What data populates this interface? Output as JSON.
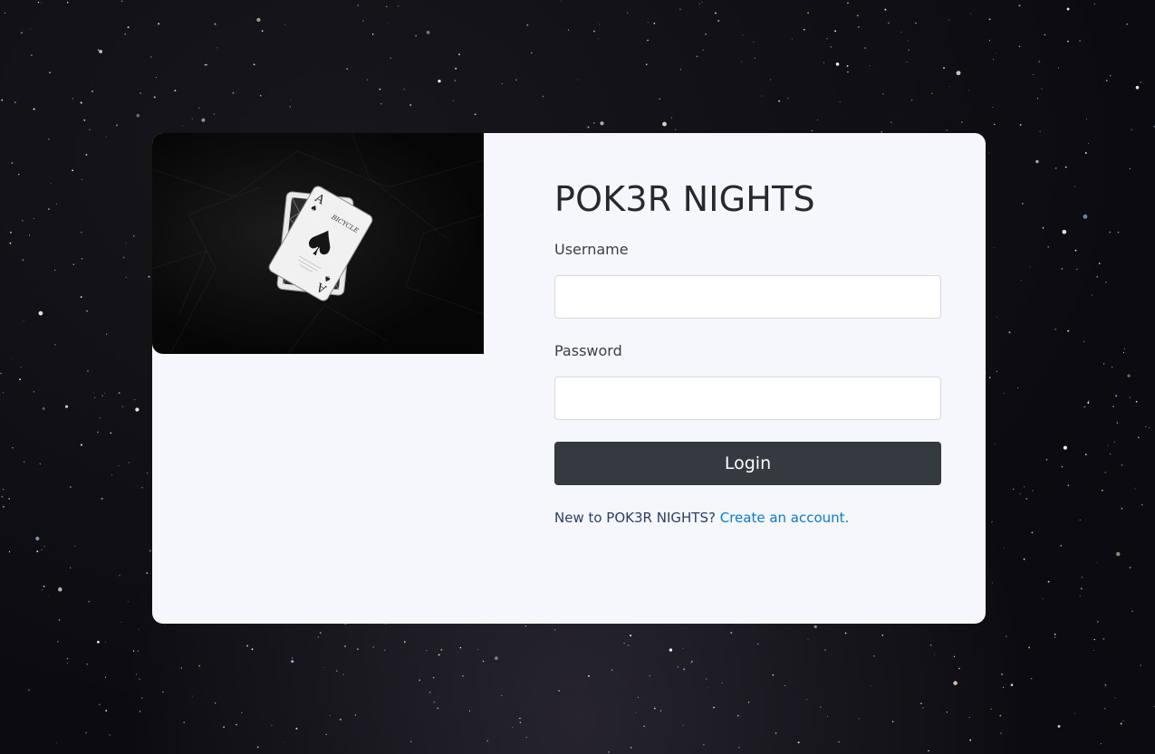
{
  "app": {
    "title": "POK3R NIGHTS"
  },
  "hero": {
    "image_description_icon": "playing-cards-icon",
    "card_rank": "A",
    "card_suit": "♠",
    "card_brand": "BICYCLE"
  },
  "form": {
    "username_label": "Username",
    "username_value": "",
    "password_label": "Password",
    "password_value": "",
    "login_label": "Login",
    "signup_prompt": "New to POK3R NIGHTS?",
    "signup_link": "Create an account."
  },
  "colors": {
    "page_bg": "#0d0d11",
    "card_bg": "#f6f7fb",
    "button_bg": "#343a40",
    "link": "#0b7ad1",
    "prompt_text": "#2c3e6b"
  }
}
